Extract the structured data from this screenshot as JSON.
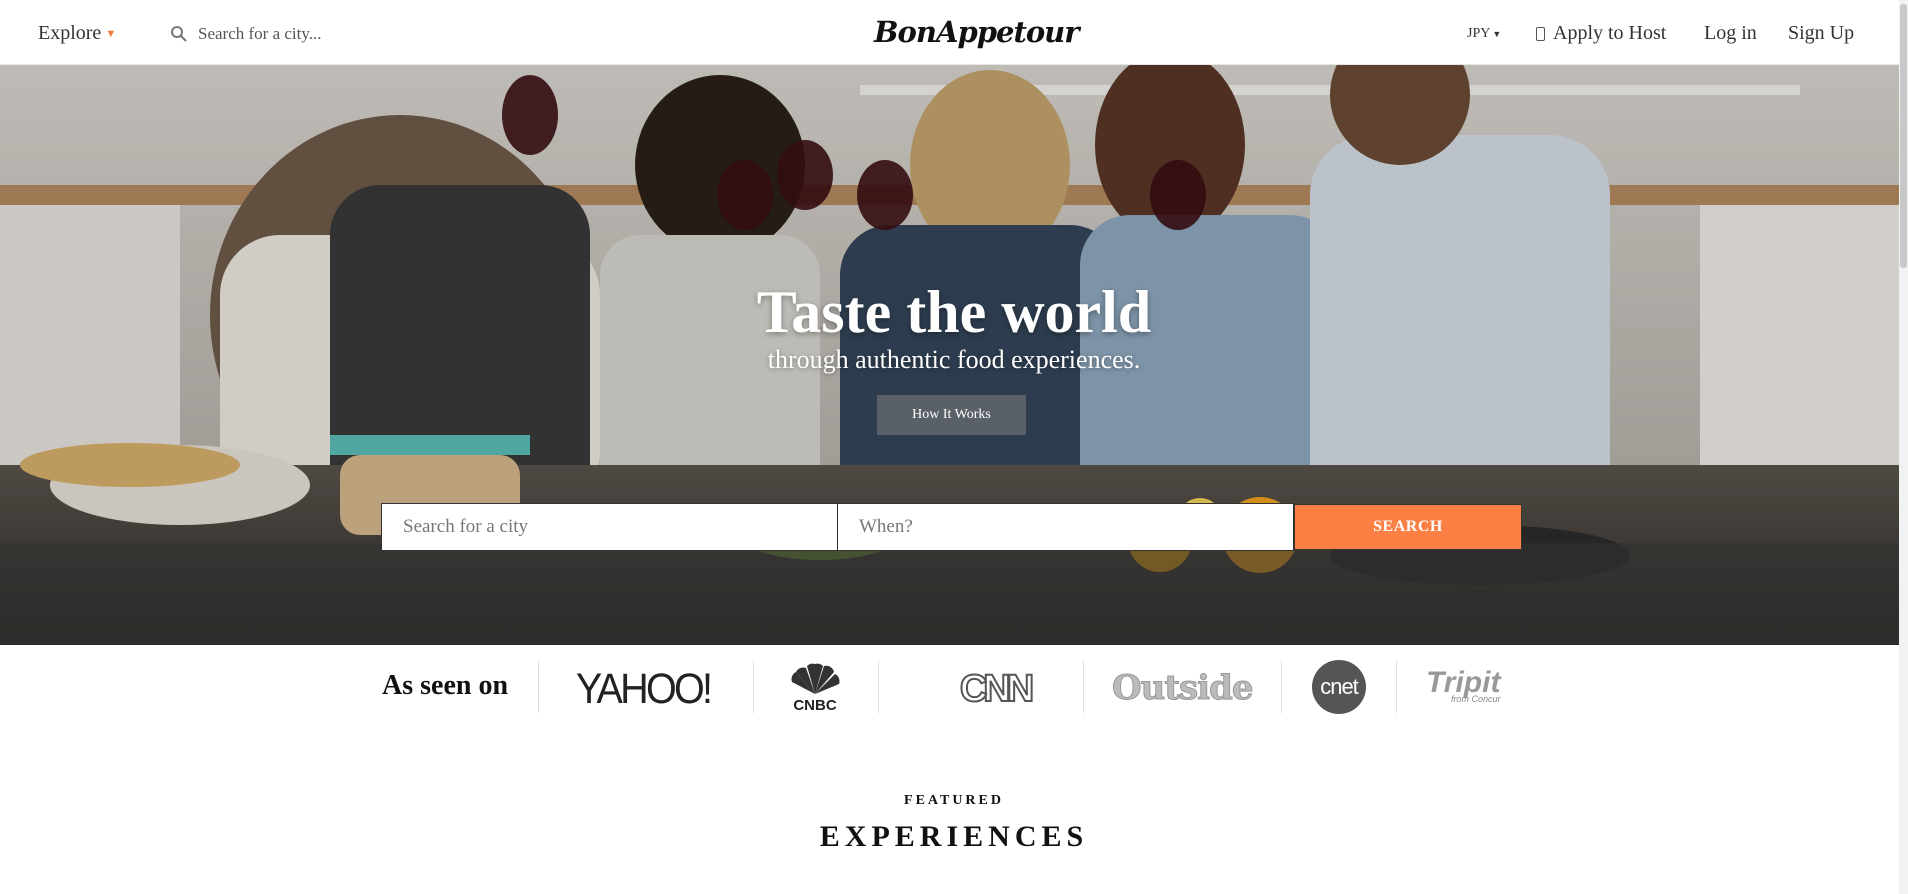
{
  "nav": {
    "explore_label": "Explore",
    "search_placeholder": "Search for a city...",
    "logo_text": "BonAppetour",
    "currency": "JPY",
    "apply_label": "Apply to Host",
    "login_label": "Log in",
    "signup_label": "Sign Up"
  },
  "hero": {
    "title": "Taste the world",
    "subtitle": "through authentic food experiences.",
    "how_button": "How It Works",
    "city_placeholder": "Search for a city",
    "when_placeholder": "When?",
    "search_button": "SEARCH"
  },
  "press": {
    "heading": "As seen on",
    "yahoo": "YAHOO!",
    "cnbc": "CNBC",
    "cnn": "CNN",
    "outside": "Outside",
    "cnet": "cnet",
    "tripit": "Tripit",
    "tripit_sub": "from Concur"
  },
  "featured": {
    "small": "FEATURED",
    "big": "EXPERIENCES"
  },
  "colors": {
    "accent": "#fc7f43",
    "caret": "#f47c3c"
  }
}
